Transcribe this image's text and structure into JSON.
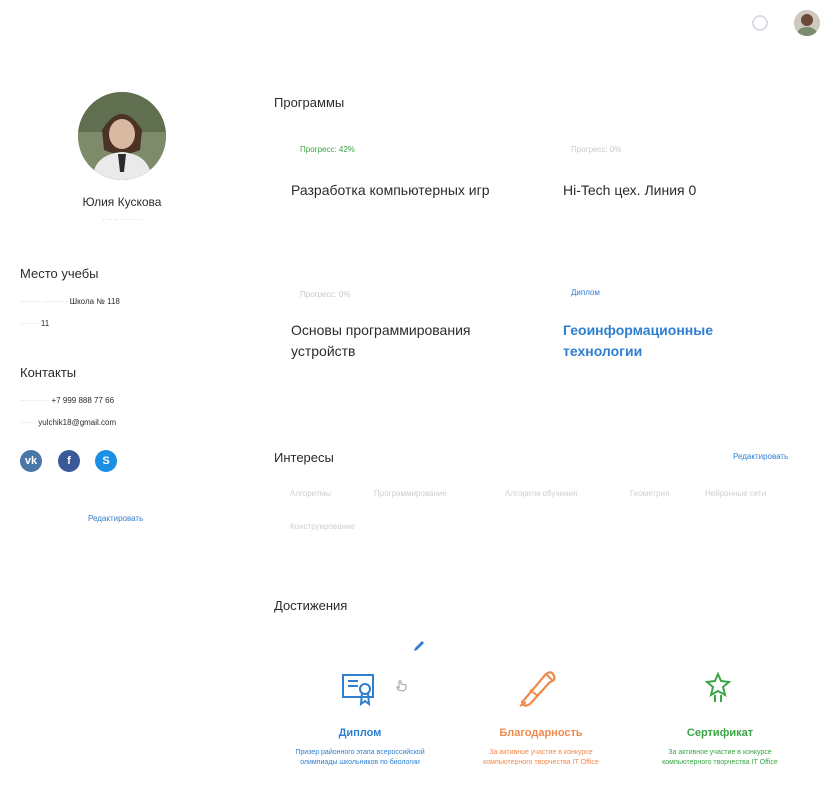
{
  "colors": {
    "accent": "#2f7fd0",
    "green": "#3aa545",
    "orange": "#f08a4b",
    "vk": "#4a76a8",
    "fb": "#3b5998",
    "skype": "#1a8fe3"
  },
  "profile": {
    "name": "Юлия Кускова",
    "subtitle": "······ ········",
    "study_heading": "Место учебы",
    "school_label": "········ ·········",
    "school_value": "Школа № 118",
    "class_label": "·······",
    "class_value": "11",
    "contacts_heading": "Контакты",
    "phone_label": "···········",
    "phone_value": "+7 999 888 77 66",
    "email_label": "······",
    "email_value": "yulchik18@gmail.com",
    "social_icons": [
      "vk-icon",
      "facebook-icon",
      "skype-icon"
    ],
    "edit_label": "Редактировать"
  },
  "programs": {
    "heading": "Программы",
    "items": [
      {
        "progress_label": "Прогресс: 42%",
        "progress": 0.42,
        "title": "Разработка компьютерных игр"
      },
      {
        "progress_label": "Прогресс: 0%",
        "progress": 0,
        "title": "Hi-Tech цех. Линия 0"
      },
      {
        "progress_label": "Прогресс: 0%",
        "progress": 0,
        "title": "Основы программирования устройств"
      },
      {
        "progress_label": "Диплом",
        "title": "Геоинформационные технологии"
      }
    ]
  },
  "interests": {
    "heading": "Интересы",
    "edit_label": "Редактировать",
    "tags": [
      "Алгоритмы",
      "Программирование",
      "Алгоритм обучения",
      "Геометрия",
      "Нейронные сети",
      "Конструирование"
    ]
  },
  "achievements": {
    "heading": "Достижения",
    "items": [
      {
        "title": "Диплом",
        "desc": "Призер районного этапа всероссийской олимпиады школьников по биологии",
        "icon": "diploma-icon"
      },
      {
        "title": "Благодарность",
        "desc": "За активное участие в конкурсе компьютерного творчества IT Office",
        "icon": "scroll-icon"
      },
      {
        "title": "Сертификат",
        "desc": "За активное участие в конкурсе компьютерного творчества IT Office",
        "icon": "certificate-icon"
      }
    ]
  }
}
